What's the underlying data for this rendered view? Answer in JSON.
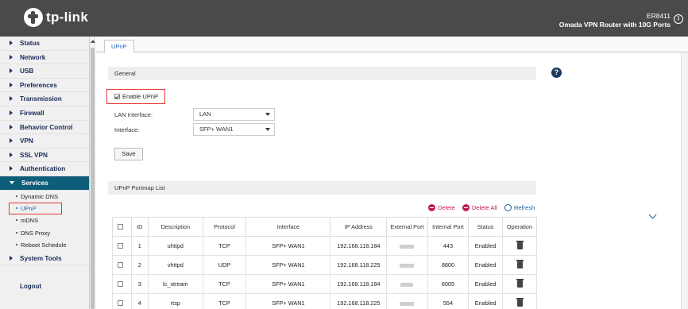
{
  "header": {
    "brand": "tp-link",
    "model_line1": "ER8411",
    "model_line2": "Omada VPN Router with 10G Ports",
    "info_glyph": "i"
  },
  "sidebar": {
    "items": [
      {
        "label": "Status"
      },
      {
        "label": "Network"
      },
      {
        "label": "USB"
      },
      {
        "label": "Preferences"
      },
      {
        "label": "Transmission"
      },
      {
        "label": "Firewall"
      },
      {
        "label": "Behavior Control"
      },
      {
        "label": "VPN"
      },
      {
        "label": "SSL VPN"
      },
      {
        "label": "Authentication"
      },
      {
        "label": "Services"
      }
    ],
    "sub_items": [
      "Dynamic DNS",
      "UPnP",
      "mDNS",
      "DNS Proxy",
      "Reboot Schedule"
    ],
    "after": [
      {
        "label": "System Tools"
      }
    ],
    "logout": "Logout"
  },
  "tab": {
    "label": "UPnP"
  },
  "general": {
    "title": "General",
    "enable_label": "Enable UPnP",
    "lan_interface_label": "LAN Interface:",
    "lan_interface_value": "LAN",
    "interface_label": "Interface:",
    "interface_value": "SFP+ WAN1",
    "save_label": "Save",
    "help_glyph": "?"
  },
  "portmap": {
    "title": "UPnP Portmap List",
    "delete_label": "Delete",
    "delete_all_label": "Delete All",
    "refresh_label": "Refresh",
    "columns": [
      "ID",
      "Description",
      "Protocol",
      "Interface",
      "IP Address",
      "External Port",
      "Internal Port",
      "Status",
      "Operation"
    ],
    "rows": [
      {
        "id": "1",
        "description": "uhttpd",
        "protocol": "TCP",
        "interface": "SFP+ WAN1",
        "ip": "192.168.118.184",
        "internal_port": "443",
        "status": "Enabled"
      },
      {
        "id": "2",
        "description": "vhttpd",
        "protocol": "UDP",
        "interface": "SFP+ WAN1",
        "ip": "192.168.118.225",
        "internal_port": "8800",
        "status": "Enabled"
      },
      {
        "id": "3",
        "description": "lc_stream",
        "protocol": "TCP",
        "interface": "SFP+ WAN1",
        "ip": "192.168.118.184",
        "internal_port": "6005",
        "status": "Enabled"
      },
      {
        "id": "4",
        "description": "rtsp",
        "protocol": "TCP",
        "interface": "SFP+ WAN1",
        "ip": "192.168.118.225",
        "internal_port": "554",
        "status": "Enabled"
      }
    ]
  },
  "colors": {
    "header_bg": "#4a4a4a",
    "active_nav_bg": "#0e5e79",
    "link_blue": "#1565c0",
    "delete_red": "#c2185b",
    "highlight_border": "#e53935"
  }
}
